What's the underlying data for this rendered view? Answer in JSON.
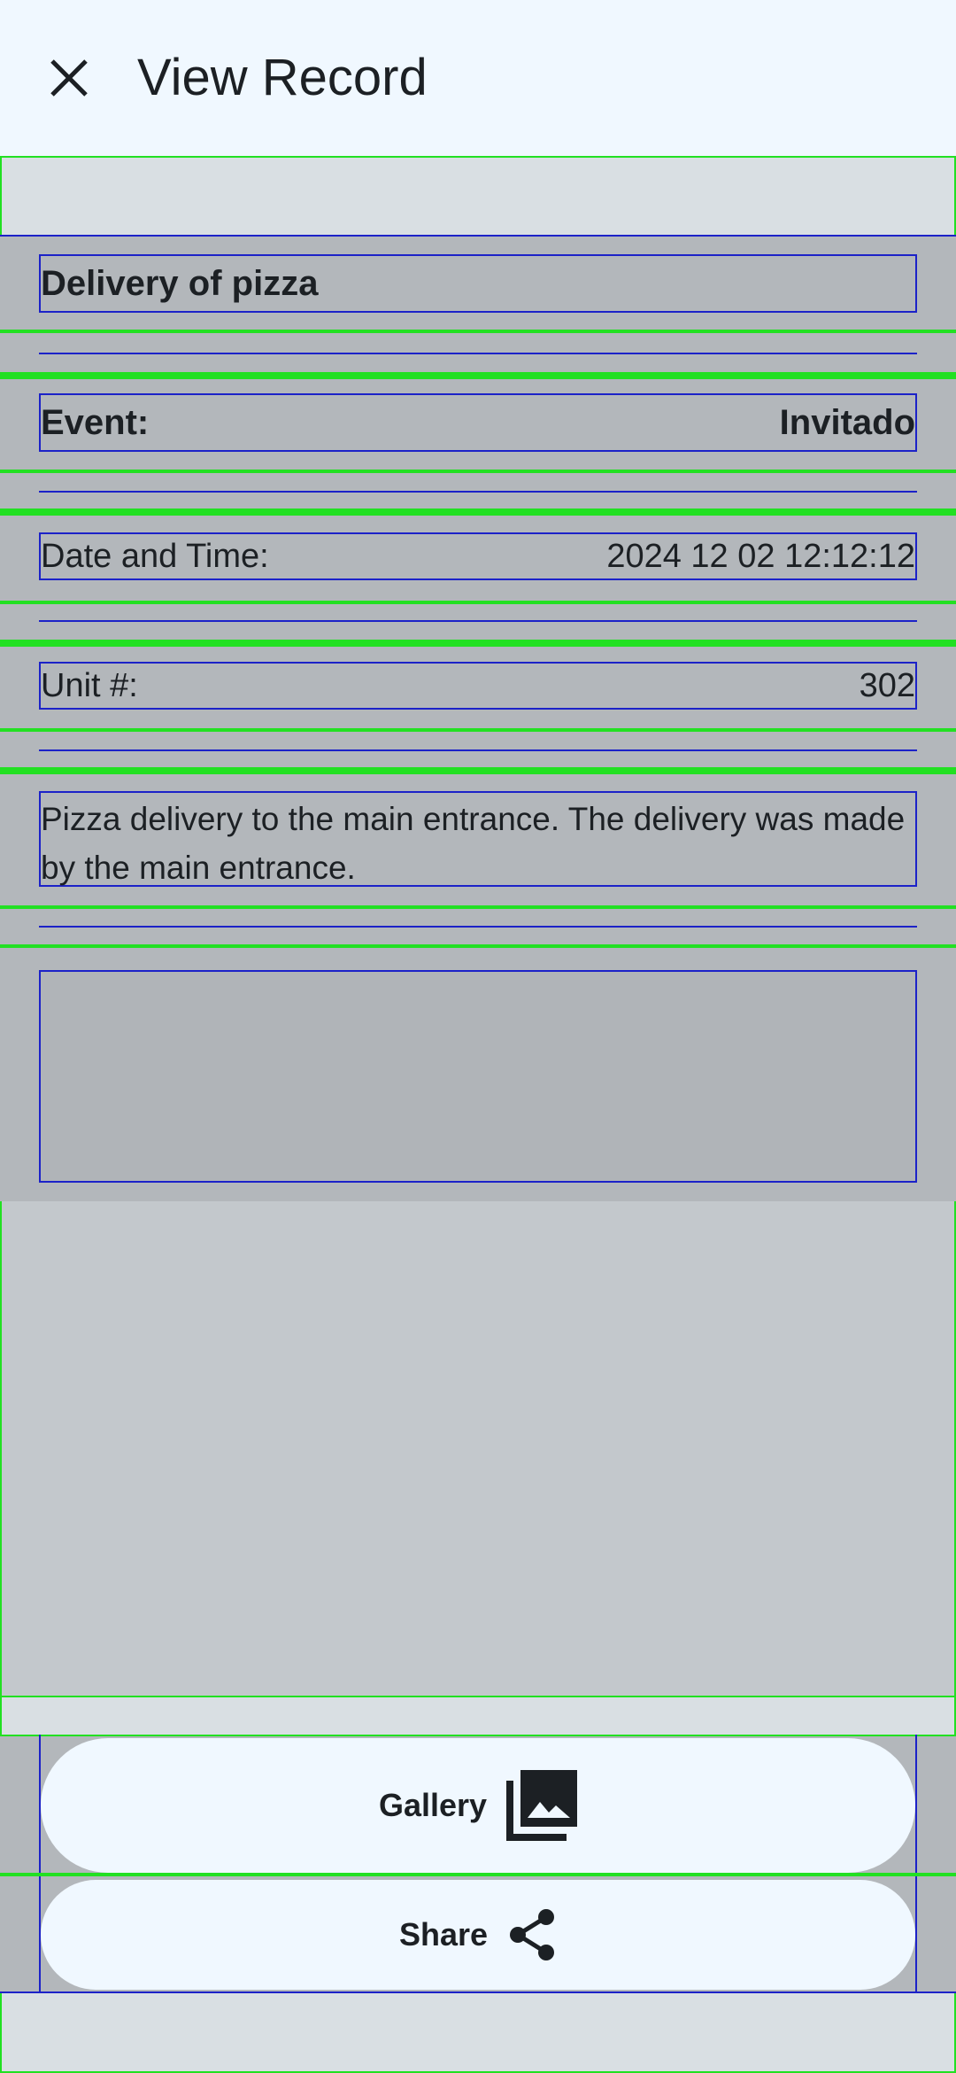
{
  "header": {
    "title": "View Record",
    "close_icon": "close-icon"
  },
  "record": {
    "heading": "Delivery of pizza",
    "event_label": "Event:",
    "event_value": "Invitado",
    "datetime_label": "Date and Time:",
    "datetime_value": "2024 12 02 12:12:12",
    "unit_label": "Unit #:",
    "unit_value": "302",
    "description": "Pizza delivery to the main entrance. The delivery was made by the main entrance."
  },
  "actions": {
    "gallery_label": "Gallery",
    "gallery_icon": "photo-library-icon",
    "share_label": "Share",
    "share_icon": "share-icon"
  }
}
